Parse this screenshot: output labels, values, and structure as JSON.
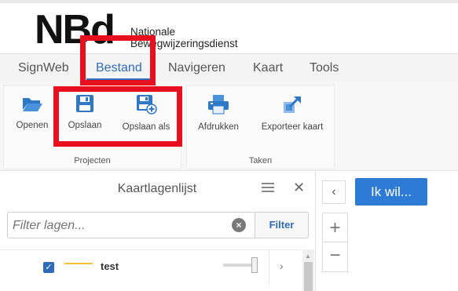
{
  "header": {
    "logo": "NBd",
    "org_line1": "Nationale",
    "org_line2": "Bewegwijzeringsdienst"
  },
  "menu": {
    "items": [
      {
        "label": "SignWeb"
      },
      {
        "label": "Bestand",
        "active": true
      },
      {
        "label": "Navigeren"
      },
      {
        "label": "Kaart"
      },
      {
        "label": "Tools"
      }
    ]
  },
  "ribbon": {
    "buttons": [
      {
        "label": "Openen",
        "icon": "folder-open-icon"
      },
      {
        "label": "Opslaan",
        "icon": "save-icon"
      },
      {
        "label": "Opslaan als",
        "icon": "save-as-icon"
      },
      {
        "label": "Afdrukken",
        "icon": "printer-icon"
      },
      {
        "label": "Exporteer kaart",
        "icon": "export-map-icon"
      }
    ],
    "groups": [
      {
        "label": "Projecten"
      },
      {
        "label": "Taken"
      }
    ]
  },
  "layer_panel": {
    "title": "Kaartlagenlijst",
    "filter_placeholder": "Filter lagen...",
    "filter_button": "Filter",
    "layers": [
      {
        "name": "test",
        "checked": true,
        "line_color": "#f1c232",
        "opacity": 1.0
      }
    ]
  },
  "map": {
    "ik_wil_button": "Ik wil...",
    "collapse_icon": "chevron-left-icon",
    "zoom_in": "+",
    "zoom_out": "−"
  },
  "colors": {
    "accent": "#2e6bb8",
    "highlight": "#e8101e",
    "button_blue": "#2e7bd6"
  }
}
